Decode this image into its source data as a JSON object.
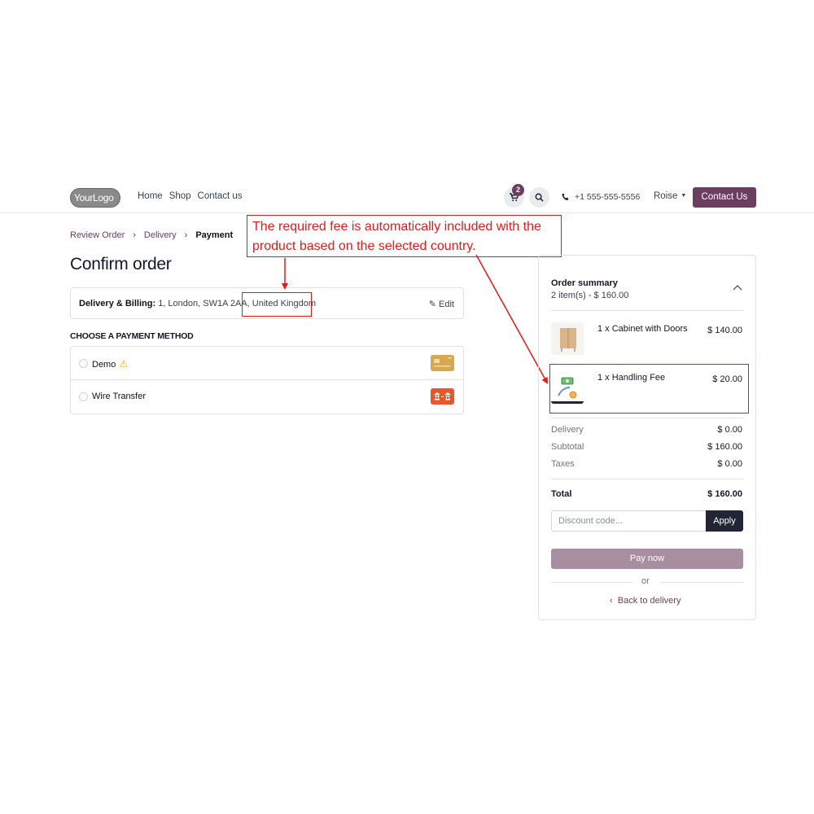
{
  "header": {
    "logo_text": "YourLogo",
    "nav": [
      "Home",
      "Shop",
      "Contact us"
    ],
    "cart_count": "2",
    "phone": "+1 555-555-5556",
    "user": "Roise",
    "contact_button": "Contact Us"
  },
  "breadcrumb": {
    "items": [
      "Review Order",
      "Delivery",
      "Payment"
    ]
  },
  "page_title": "Confirm order",
  "delivery": {
    "label": "Delivery & Billing:",
    "address": "1, London, SW1A 2AA, United Kingdom",
    "edit_label": "Edit"
  },
  "payment": {
    "heading": "CHOOSE A PAYMENT METHOD",
    "methods": [
      {
        "label": "Demo",
        "icon": "credit-card-icon",
        "color": "#d8a84e"
      },
      {
        "label": "Wire Transfer",
        "icon": "bank-transfer-icon",
        "color": "#e8562a"
      }
    ]
  },
  "annotation": {
    "line1": "The required fee is automatically included with the",
    "line2": "product based on the selected country."
  },
  "summary": {
    "title": "Order summary",
    "count": "2 item(s) -  $ 160.00",
    "items": [
      {
        "name": "1 x Cabinet with Doors",
        "price": "$ 140.00"
      },
      {
        "name": "1 x Handling Fee",
        "price": "$ 20.00"
      }
    ],
    "rows": [
      {
        "label": "Delivery",
        "value": "$ 0.00"
      },
      {
        "label": "Subtotal",
        "value": "$ 160.00"
      },
      {
        "label": "Taxes",
        "value": "$ 0.00"
      }
    ],
    "total_label": "Total",
    "total_value": "$ 160.00",
    "discount_placeholder": "Discount code...",
    "apply_label": "Apply",
    "pay_label": "Pay now",
    "or_label": "or",
    "back_label": "Back to delivery"
  },
  "colors": {
    "brand": "#6b3d5e",
    "annotation": "#e21a1a",
    "pay_button": "#a88ea0"
  }
}
